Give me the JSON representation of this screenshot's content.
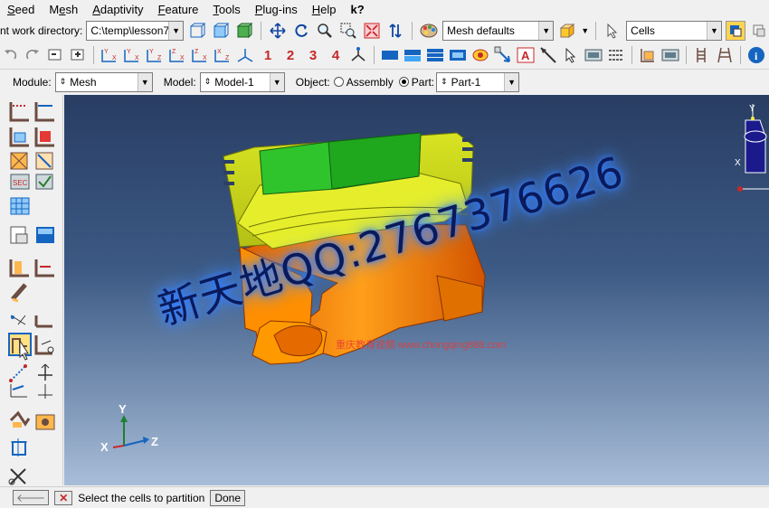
{
  "menubar": {
    "items": [
      {
        "label": "Seed",
        "ul": "S"
      },
      {
        "label": "Mesh",
        "ul": "e"
      },
      {
        "label": "Adaptivity",
        "ul": "A"
      },
      {
        "label": "Feature",
        "ul": "F"
      },
      {
        "label": "Tools",
        "ul": "T"
      },
      {
        "label": "Plug-ins",
        "ul": "P"
      },
      {
        "label": "Help",
        "ul": "H"
      }
    ],
    "help_cursor_icon": "k?"
  },
  "toolbar1": {
    "workdir_label": "nt work directory:",
    "workdir_value": "C:\\temp\\lesson7",
    "mesh_defaults": "Mesh defaults",
    "selection_filter": "Cells"
  },
  "toolbar2": {
    "numbers": [
      "1",
      "2",
      "3",
      "4"
    ]
  },
  "context": {
    "module_label": "Module:",
    "module_value": "Mesh",
    "model_label": "Model:",
    "model_value": "Model-1",
    "object_label": "Object:",
    "assembly_label": "Assembly",
    "part_label": "Part:",
    "part_value": "Part-1"
  },
  "viewport": {
    "triad": {
      "y": "Y",
      "x": "X",
      "z": "Z"
    },
    "view_cube": {
      "y": "Y",
      "x": "X"
    },
    "watermark": "新天地QQ:2767376626",
    "watermark2": "重庆教育视频 www.chongqing888.com"
  },
  "status": {
    "prompt": "Select the cells to partition",
    "done": "Done"
  }
}
